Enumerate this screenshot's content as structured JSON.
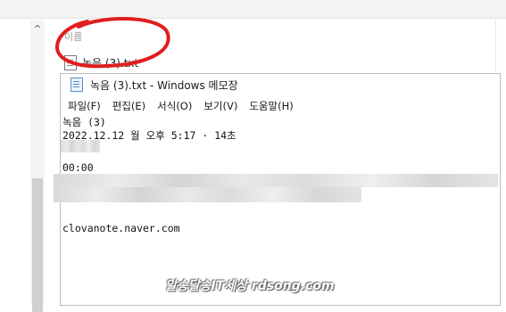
{
  "explorer": {
    "column_header": "이름",
    "file_name": "녹음 (3).txt"
  },
  "notepad": {
    "title": "녹음 (3).txt - Windows 메모장",
    "menu": [
      "파일(F)",
      "편집(E)",
      "서식(O)",
      "보기(V)",
      "도움말(H)"
    ],
    "lines": {
      "line1": "녹음 (3)",
      "line2": "2022.12.12 월 오후 5:17 · 14초",
      "line3": "00:00",
      "line4": "clovanote.naver.com"
    }
  },
  "watermark": "알송달송IT세상 rdsong.com",
  "colors": {
    "annotation": "#e01e1e"
  }
}
